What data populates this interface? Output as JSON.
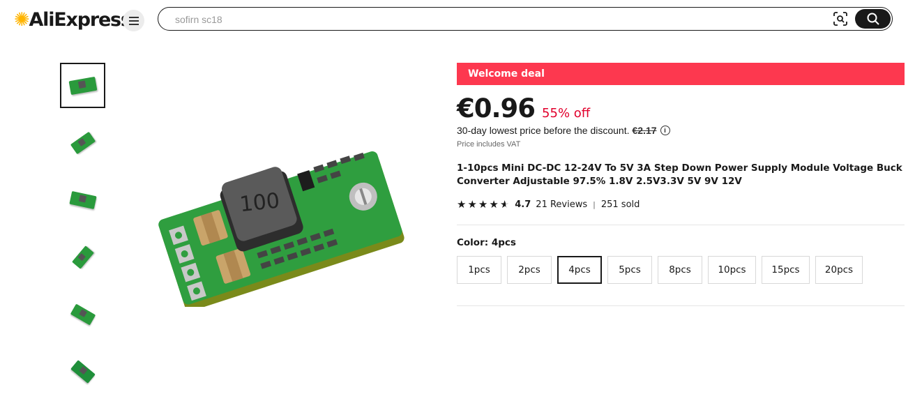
{
  "header": {
    "logo_text": "AliExpress",
    "search": {
      "value": "",
      "placeholder": "sofirn sc18"
    },
    "icons": {
      "menu": "hamburger-menu-icon",
      "image_search": "camera-scan-icon",
      "search": "search-icon"
    }
  },
  "gallery": {
    "thumbnail_count": 6,
    "active_index": 0
  },
  "product": {
    "deal_banner": "Welcome deal",
    "price": "€0.96",
    "discount": "55% off",
    "lowest_price_text": "30-day lowest price before the discount.",
    "old_price": "€2.17",
    "vat_note": "Price includes VAT",
    "title": "1-10pcs Mini DC-DC 12-24V To 5V 3A Step Down Power Supply Module Voltage Buck Converter Adjustable 97.5% 1.8V 2.5V3.3V 5V 9V 12V",
    "rating": "4.7",
    "rating_stars": 4.7,
    "reviews": "21 Reviews",
    "sold": "251 sold",
    "color_label": "Color: 4pcs",
    "options": [
      {
        "label": "1pcs",
        "selected": false
      },
      {
        "label": "2pcs",
        "selected": false
      },
      {
        "label": "4pcs",
        "selected": true
      },
      {
        "label": "5pcs",
        "selected": false
      },
      {
        "label": "8pcs",
        "selected": false
      },
      {
        "label": "10pcs",
        "selected": false
      },
      {
        "label": "15pcs",
        "selected": false
      },
      {
        "label": "20pcs",
        "selected": false
      }
    ]
  },
  "colors": {
    "deal_red": "#fd384f",
    "discount_red": "#e1002c",
    "text": "#191919",
    "pcb_green": "#2a9a3c"
  }
}
